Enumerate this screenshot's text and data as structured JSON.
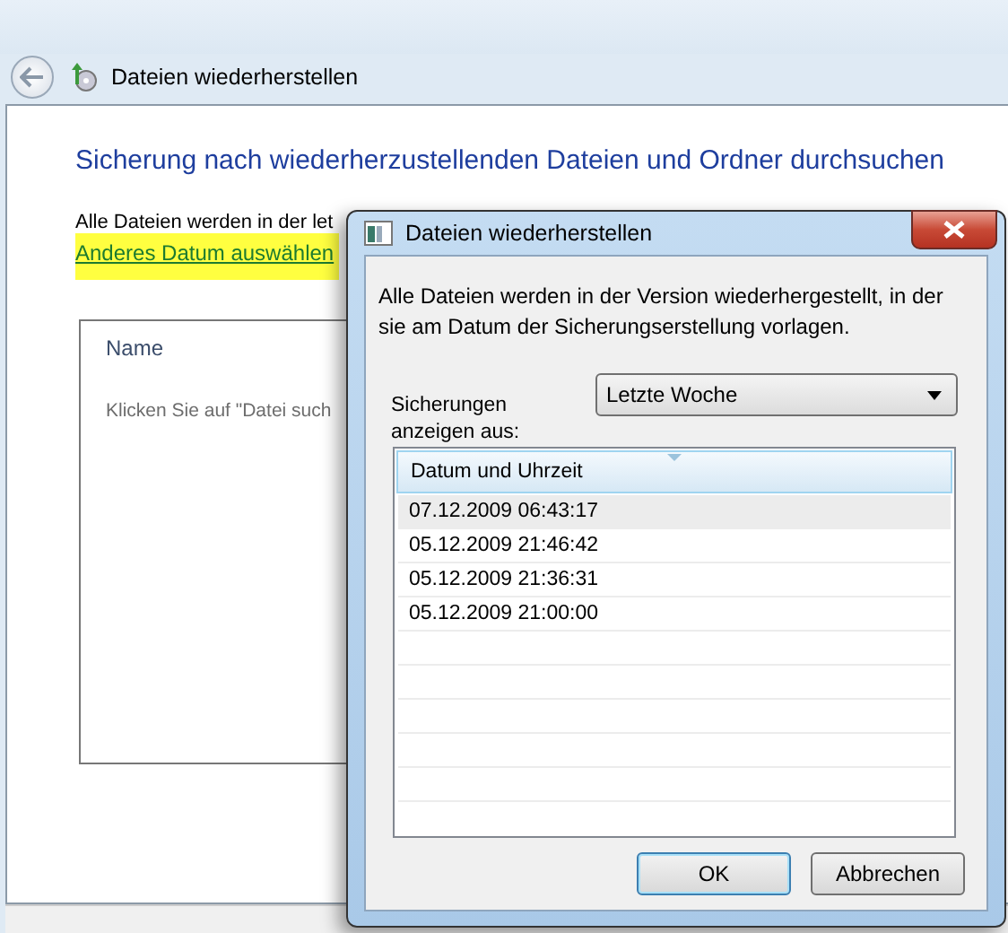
{
  "window": {
    "title": "Dateien wiederherstellen"
  },
  "main": {
    "heading": "Sicherung nach wiederherzustellenden Dateien und Ordner durchsuchen",
    "info": "Alle Dateien werden in der let",
    "link": "Anderes Datum auswählen",
    "list": {
      "columns": [
        "Name"
      ],
      "empty_hint": "Klicken Sie auf \"Datei such"
    }
  },
  "dialog": {
    "title": "Dateien wiederherstellen",
    "message": "Alle Dateien werden in der Version wiederhergestellt, in der sie am Datum der Sicherungserstellung vorlagen.",
    "source_label": "Sicherungen anzeigen aus:",
    "source_value": "Letzte Woche",
    "table": {
      "columns": [
        "Datum und Uhrzeit"
      ],
      "rows": [
        {
          "date": "07.12.2009 06:43:17",
          "selected": true
        },
        {
          "date": "05.12.2009 21:46:42",
          "selected": false
        },
        {
          "date": "05.12.2009 21:36:31",
          "selected": false
        },
        {
          "date": "05.12.2009 21:00:00",
          "selected": false
        }
      ]
    },
    "buttons": [
      {
        "label": "OK",
        "default": true
      },
      {
        "label": "Abbrechen",
        "default": false
      }
    ]
  }
}
